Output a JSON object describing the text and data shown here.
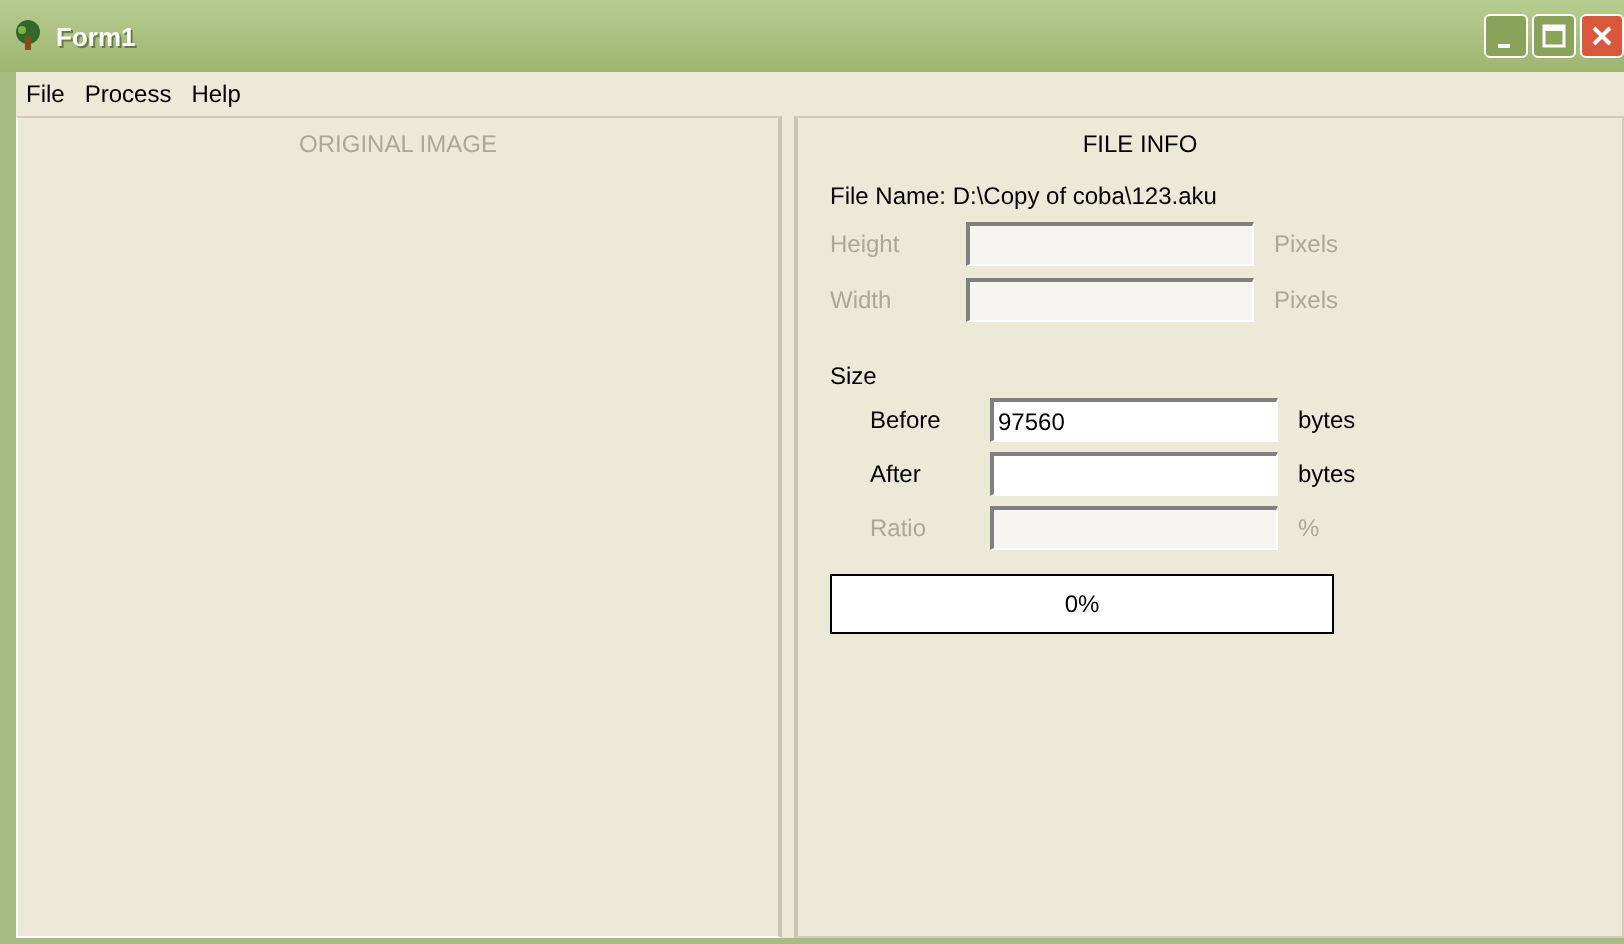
{
  "window": {
    "title": "Form1"
  },
  "menu": [
    "File",
    "Process",
    "Help"
  ],
  "left_panel": {
    "title": "ORIGINAL IMAGE",
    "disabled": true
  },
  "file_info": {
    "title": "FILE INFO",
    "file_name": "File Name: D:\\Copy of coba\\123.aku",
    "dimension_fields": [
      {
        "label": "Height",
        "unit": "Pixels",
        "disabled": true
      },
      {
        "label": "Width",
        "unit": "Pixels",
        "disabled": true
      }
    ],
    "size_label": "Size",
    "size_fields": [
      {
        "label": "Before",
        "value": "97560",
        "unit": "bytes",
        "disabled": false
      },
      {
        "label": "After",
        "unit": "bytes",
        "disabled": false
      },
      {
        "label": "Ratio",
        "unit": "%",
        "disabled": true
      }
    ],
    "progress": {
      "level": 0,
      "reading": "0%"
    }
  }
}
